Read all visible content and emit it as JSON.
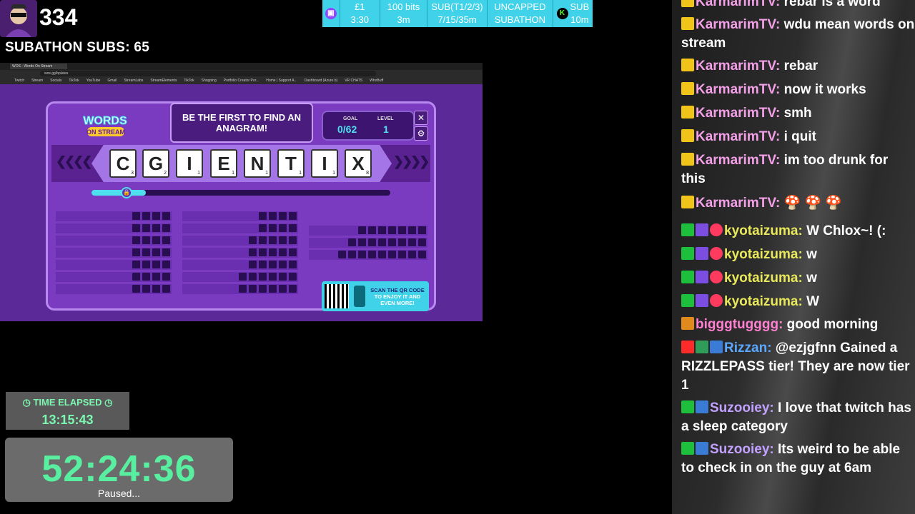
{
  "overlay": {
    "viewer_count": "334",
    "subathon_subs": "SUBATHON SUBS: 65"
  },
  "ticker": [
    {
      "top": "£1",
      "bottom": "3:30"
    },
    {
      "top": "100 bits",
      "bottom": "3m"
    },
    {
      "top": "SUB(T1/2/3)",
      "bottom": "7/15/35m"
    },
    {
      "top": "UNCAPPED",
      "bottom": "SUBATHON"
    },
    {
      "top": "SUB",
      "bottom": "10m"
    }
  ],
  "ticker_logo_letter": "K",
  "browser": {
    "tab_title": "WOS - Words On Stream",
    "url": "wos.gg/bplates",
    "bookmarks": [
      "Twitch",
      "Stream",
      "Socials",
      "TikTok",
      "YouTube",
      "Gmail",
      "StreamLabs",
      "StreamElements",
      "TikTok",
      "Shopping",
      "Portfolio Creator Por...",
      "Home | Support A...",
      "Dashboard (Azure b)",
      "VR CHATS",
      "WhoBuff"
    ]
  },
  "game": {
    "logo_line1": "WORDS",
    "logo_line2": "ON STREAM",
    "prompt": "BE THE FIRST TO FIND AN ANAGRAM!",
    "goal_label": "GOAL",
    "goal_value": "0/62",
    "level_label": "LEVEL",
    "level_value": "1",
    "close_symbol": "✕",
    "settings_symbol": "⚙",
    "tiles": [
      {
        "letter": "C",
        "score": "3"
      },
      {
        "letter": "G",
        "score": "2"
      },
      {
        "letter": "I",
        "score": "1"
      },
      {
        "letter": "E",
        "score": "1"
      },
      {
        "letter": "N",
        "score": "1"
      },
      {
        "letter": "T",
        "score": "1"
      },
      {
        "letter": "I",
        "score": "1"
      },
      {
        "letter": "X",
        "score": "8"
      }
    ],
    "progress": 0.12,
    "qr_text_1": "SCAN THE QR CODE",
    "qr_text_2": "TO ENJOY IT AND EVEN MORE!"
  },
  "timers": {
    "elapsed_label": "TIME ELAPSED",
    "elapsed_value": "13:15:43",
    "countdown_value": "52:24:36",
    "countdown_status": "Paused..."
  },
  "chat": [
    {
      "badges": [
        "mod"
      ],
      "user": "KarmarimTV",
      "color": "#f4a0e8",
      "text": "rebar is a word"
    },
    {
      "badges": [
        "mod"
      ],
      "user": "KarmarimTV",
      "color": "#f4a0e8",
      "text": "wdu mean words on stream"
    },
    {
      "badges": [
        "mod"
      ],
      "user": "KarmarimTV",
      "color": "#f4a0e8",
      "text": "rebar"
    },
    {
      "badges": [
        "mod"
      ],
      "user": "KarmarimTV",
      "color": "#f4a0e8",
      "text": "now it works"
    },
    {
      "badges": [
        "mod"
      ],
      "user": "KarmarimTV",
      "color": "#f4a0e8",
      "text": "smh"
    },
    {
      "badges": [
        "mod"
      ],
      "user": "KarmarimTV",
      "color": "#f4a0e8",
      "text": "i quit"
    },
    {
      "badges": [
        "mod"
      ],
      "user": "KarmarimTV",
      "color": "#f4a0e8",
      "text": "im too drunk for this"
    },
    {
      "badges": [
        "mod"
      ],
      "user": "KarmarimTV",
      "color": "#f4a0e8",
      "text": "🍄 🍄 🍄"
    },
    {
      "badges": [
        "vip",
        "first",
        "heart"
      ],
      "user": "kyotaizuma",
      "color": "#e8e85a",
      "text": "W Chlox~! (:"
    },
    {
      "badges": [
        "vip",
        "first",
        "heart"
      ],
      "user": "kyotaizuma",
      "color": "#e8e85a",
      "text": "w"
    },
    {
      "badges": [
        "vip",
        "first",
        "heart"
      ],
      "user": "kyotaizuma",
      "color": "#e8e85a",
      "text": "w"
    },
    {
      "badges": [
        "vip",
        "first",
        "heart"
      ],
      "user": "kyotaizuma",
      "color": "#e8e85a",
      "text": "W"
    },
    {
      "badges": [
        "azn"
      ],
      "user": "bigggtugggg",
      "color": "#ff7fd0",
      "text": "good morning"
    },
    {
      "badges": [
        "cam",
        "p",
        "gift"
      ],
      "user": "Rizzan",
      "color": "#5aa8ff",
      "text": "@ezjgfnn Gained a RIZZLEPASS tier! They are now tier 1"
    },
    {
      "badges": [
        "vip",
        "gift"
      ],
      "user": "Suzooiey",
      "color": "#c2a0ff",
      "text": "I love that twitch has a sleep category"
    },
    {
      "badges": [
        "vip",
        "gift"
      ],
      "user": "Suzooiey",
      "color": "#c2a0ff",
      "text": "Its weird to be able to check in on the guy at 6am"
    }
  ]
}
